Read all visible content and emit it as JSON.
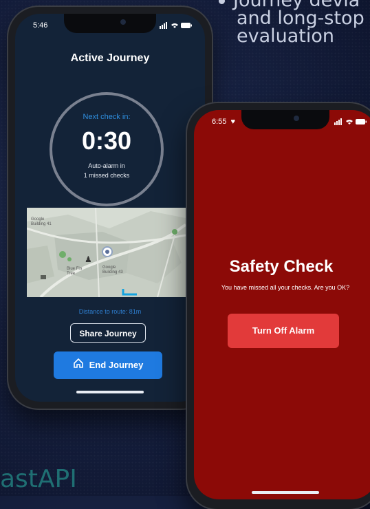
{
  "background": {
    "bullet_lines": [
      "Journey devia",
      "and long-stop",
      "evaluation"
    ],
    "brand_text": "astAPI"
  },
  "phone_left": {
    "status_time": "5:46",
    "title": "Active Journey",
    "timer": {
      "label": "Next check in:",
      "value": "0:30",
      "auto_alarm_line1": "Auto-alarm in",
      "auto_alarm_line2": "1 missed checks"
    },
    "map_labels": [
      "Google Building 41",
      "Google Building 43",
      "Blue Fin Tree"
    ],
    "distance_text": "Distance to route: 81m",
    "share_button": "Share Journey",
    "end_button": "End Journey",
    "accent_color": "#1f7ae0"
  },
  "phone_right": {
    "status_time": "6:55",
    "title": "Safety Check",
    "message": "You have missed all your checks. Are you OK?",
    "alarm_button": "Turn Off Alarm",
    "background_color": "#8c0a07",
    "button_color": "#e23a3a"
  }
}
